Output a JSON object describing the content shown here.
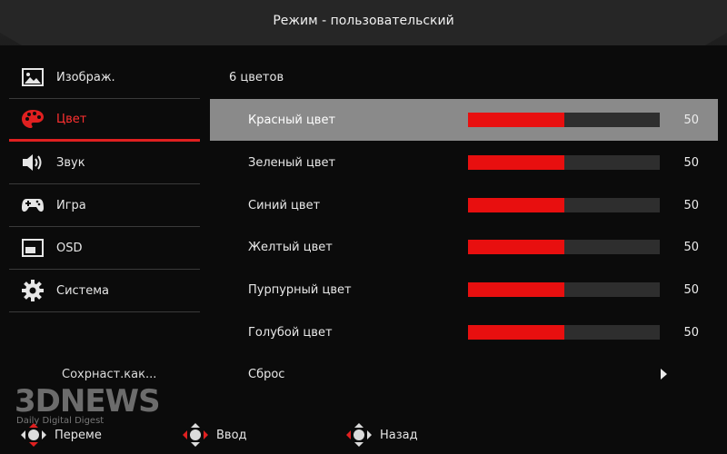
{
  "header": {
    "title": "Режим - пользовательский"
  },
  "sidebar": {
    "items": [
      {
        "label": "Изображ.",
        "icon": "image-icon",
        "active": false
      },
      {
        "label": "Цвет",
        "icon": "palette-icon",
        "active": true
      },
      {
        "label": "Звук",
        "icon": "speaker-icon",
        "active": false
      },
      {
        "label": "Игра",
        "icon": "gamepad-icon",
        "active": false
      },
      {
        "label": "OSD",
        "icon": "osd-window-icon",
        "active": false
      },
      {
        "label": "Система",
        "icon": "gear-icon",
        "active": false
      }
    ],
    "save_as": "Сохрнаст.как..."
  },
  "main": {
    "section_label": "6 цветов",
    "rows": [
      {
        "label": "Красный цвет",
        "value": "50",
        "level": 0.5,
        "selected": true
      },
      {
        "label": "Зеленый цвет",
        "value": "50",
        "level": 0.5,
        "selected": false
      },
      {
        "label": "Синий цвет",
        "value": "50",
        "level": 0.5,
        "selected": false
      },
      {
        "label": "Желтый цвет",
        "value": "50",
        "level": 0.5,
        "selected": false
      },
      {
        "label": "Пурпурный цвет",
        "value": "50",
        "level": 0.5,
        "selected": false
      },
      {
        "label": "Голубой цвет",
        "value": "50",
        "level": 0.5,
        "selected": false
      }
    ],
    "reset_label": "Сброс"
  },
  "footer": {
    "move_label": "Переме",
    "enter_label": "Ввод",
    "back_label": "Назад"
  },
  "watermark": {
    "brand": "3DNEWS",
    "tagline": "Daily Digital Digest"
  },
  "colors": {
    "accent": "#e02020",
    "bar_fill": "#e80f0f",
    "selected_row": "#8a8a8a"
  }
}
